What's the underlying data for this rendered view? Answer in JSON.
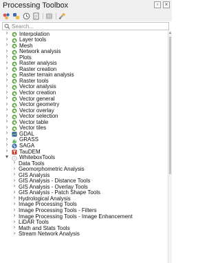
{
  "panel": {
    "title": "Processing Toolbox"
  },
  "toolbar": {
    "icons": [
      "run-model-icon",
      "python-script-icon",
      "history-icon",
      "results-viewer-icon",
      "edit-features-icon",
      "options-icon"
    ]
  },
  "search": {
    "placeholder": "Search..."
  },
  "tree": {
    "qgis_items": [
      "Interpolation",
      "Layer tools",
      "Mesh",
      "Network analysis",
      "Plots",
      "Raster analysis",
      "Raster creation",
      "Raster terrain analysis",
      "Raster tools",
      "Vector analysis",
      "Vector creation",
      "Vector general",
      "Vector geometry",
      "Vector overlay",
      "Vector selection",
      "Vector table",
      "Vector tiles"
    ],
    "providers": [
      "GDAL",
      "GRASS",
      "SAGA",
      "TauDEM"
    ],
    "whitebox": {
      "label": "WhiteboxTools",
      "children": [
        "Data Tools",
        "Geomorphometric Analysis",
        "GIS Analysis",
        "GIS Analysis - Distance Tools",
        "GIS Analysis - Overlay Tools",
        "GIS Analysis - Patch Shape Tools",
        "Hydrological Analysis",
        "Image Processing Tools",
        "Image Processing Tools - Filters",
        "Image Processing Tools - Image Enhancement",
        "LiDAR Tools",
        "Math and Stats Tools",
        "Stream Network Analysis"
      ]
    }
  },
  "colors": {
    "qgis_green": "#5a9e3a",
    "taudem_red": "#c0392b",
    "saga_blue": "#3a6ab0"
  }
}
